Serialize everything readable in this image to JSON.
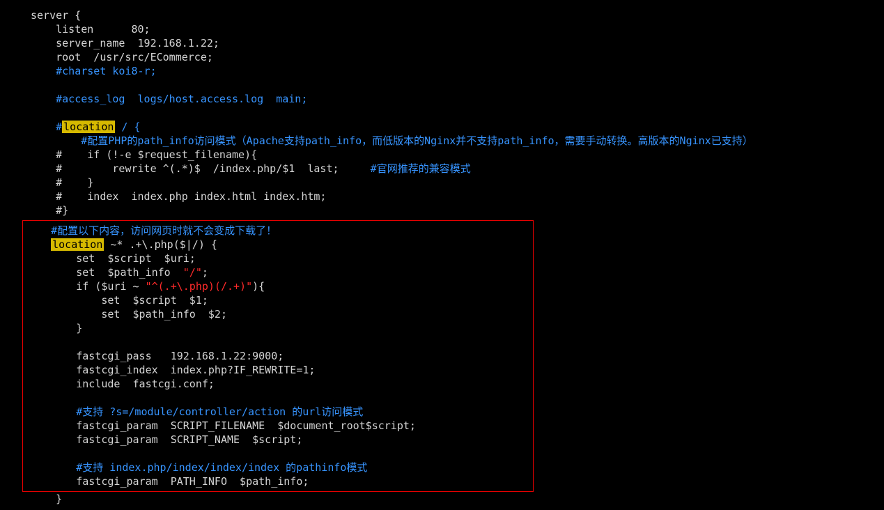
{
  "code": {
    "l1": "server {",
    "l2": "    listen      80;",
    "l3": "    server_name  192.168.1.22;",
    "l4": "    root  /usr/src/ECommerce;",
    "l5": "    #charset koi8-r;",
    "l6": "",
    "l7": "    #access_log  logs/host.access.log  main;",
    "l8": "",
    "l9a": "    #",
    "l9b": "location",
    "l9c": " / {",
    "l10": "        #配置PHP的path_info访问模式（Apache支持path_info，而低版本的Nginx并不支持path_info，需要手动转换。高版本的Nginx已支持）",
    "l11": "    #    if (!-e $request_filename){",
    "l12a": "    #        rewrite ^(.*)$  /index.php/$1  last;     ",
    "l12b": "#官网推荐的兼容模式",
    "l13": "    #    }",
    "l14": "    #    index  index.php index.html index.htm;",
    "l15": "    #}",
    "b1": "    #配置以下内容，访问网页时就不会变成下载了！",
    "b2a": "    ",
    "b2b": "location",
    "b2c": " ~* .+\\.php($|/) {",
    "b3": "        set  $script  $uri;",
    "b4a": "        set  $path_info  ",
    "b4b": "\"/\"",
    "b4c": ";",
    "b5a": "        if ($uri ~ ",
    "b5b": "\"^(.+\\.php)(/.+)\"",
    "b5c": "){",
    "b6": "            set  $script  $1;",
    "b7": "            set  $path_info  $2;",
    "b8": "        }",
    "b9": "",
    "b10": "        fastcgi_pass   192.168.1.22:9000;",
    "b11": "        fastcgi_index  index.php?IF_REWRITE=1;",
    "b12": "        include  fastcgi.conf;",
    "b13": "",
    "b14": "        #支持 ?s=/module/controller/action 的url访问模式",
    "b15": "        fastcgi_param  SCRIPT_FILENAME  $document_root$script;",
    "b16": "        fastcgi_param  SCRIPT_NAME  $script;",
    "b17": "",
    "b18": "        #支持 index.php/index/index/index 的pathinfo模式",
    "b19": "        fastcgi_param  PATH_INFO  $path_info;",
    "a1": "    }"
  }
}
